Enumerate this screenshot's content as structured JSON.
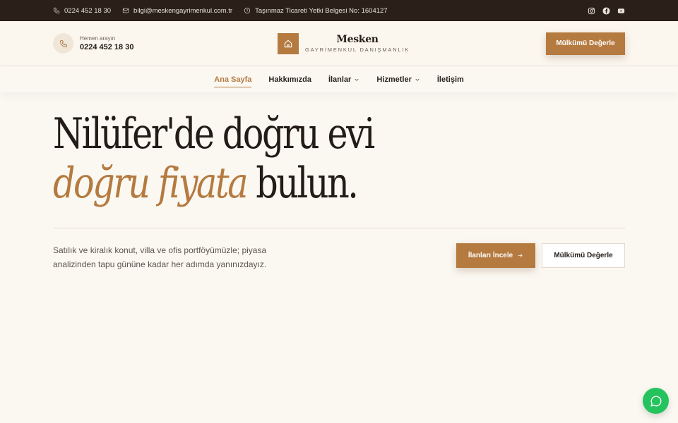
{
  "topbar": {
    "phone": "0224 452 18 30",
    "email": "bilgi@meskengayrimenkul.com.tr",
    "license": "Taşınmaz Ticareti Yetki Belgesi No: 1604127",
    "social": [
      "instagram-icon",
      "facebook-icon",
      "youtube-icon"
    ]
  },
  "header": {
    "call_label": "Hemen arayın",
    "call_number": "0224 452 18 30",
    "logo_name": "Mesken",
    "logo_sub": "GAYRİMENKUL DANIŞMANLIK",
    "cta_label": "Mülkümü Değerle"
  },
  "nav": {
    "items": [
      {
        "label": "Ana Sayfa",
        "active": true
      },
      {
        "label": "Hakkımızda"
      },
      {
        "label": "İlanlar",
        "dropdown": true
      },
      {
        "label": "Hizmetler",
        "dropdown": true
      },
      {
        "label": "İletişim"
      }
    ]
  },
  "hero": {
    "line1": "Nilüfer'de doğru evi",
    "line2_accent": "doğru fiyata",
    "line2_rest": " bulun.",
    "description": "Satılık ve kiralık konut, villa ve ofis portföyümüzle; piyasa analizinden tapu gününe kadar her adımda yanınızdayız.",
    "primary_button": "İlanları İncele",
    "secondary_button": "Mülkümü Değerle"
  },
  "colors": {
    "accent": "#b57a3f",
    "topbar": "#2a2019",
    "background": "#fbf8f2",
    "whatsapp": "#25c35d"
  }
}
